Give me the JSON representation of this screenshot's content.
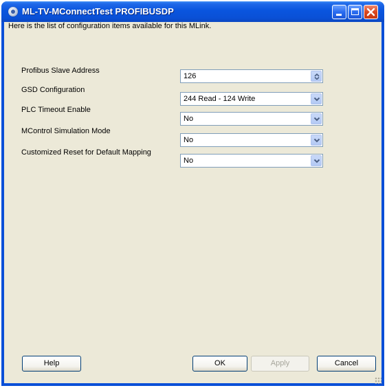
{
  "window": {
    "title": "ML-TV-MConnectTest PROFIBUSDP"
  },
  "intro_text": "Here is the list of configuration items available for this MLink.",
  "fields": [
    {
      "label": "Profibus Slave Address",
      "value": "126",
      "control": "spinner"
    },
    {
      "label": "GSD Configuration",
      "value": "244 Read - 124 Write",
      "control": "dropdown"
    },
    {
      "label": "PLC Timeout Enable",
      "value": "No",
      "control": "dropdown"
    },
    {
      "label": "MControl Simulation Mode",
      "value": "No",
      "control": "dropdown"
    },
    {
      "label": "Customized Reset for Default Mapping",
      "value": "No",
      "control": "dropdown"
    }
  ],
  "buttons": {
    "help": "Help",
    "ok": "OK",
    "apply": "Apply",
    "cancel": "Cancel"
  },
  "colors": {
    "titlebar": "#0a55de",
    "client_bg": "#ece9d8",
    "field_border": "#7f9db9",
    "disabled_text": "#a6a59b"
  }
}
